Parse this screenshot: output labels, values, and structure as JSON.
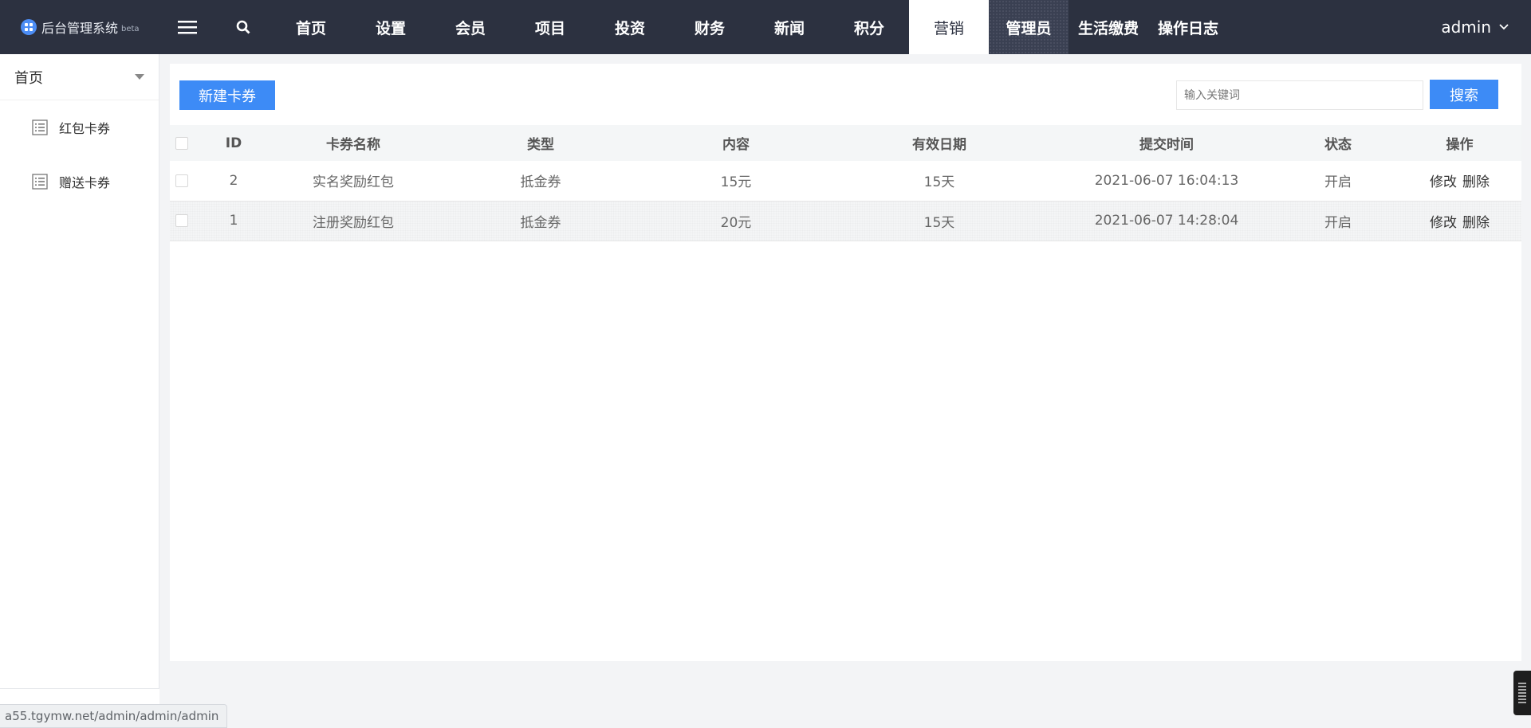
{
  "brand": {
    "title": "后台管理系统",
    "tag": "beta"
  },
  "nav": {
    "items": [
      "首页",
      "设置",
      "会员",
      "项目",
      "投资",
      "财务",
      "新闻",
      "积分",
      "营销",
      "管理员",
      "生活缴费",
      "操作日志"
    ],
    "active": "营销",
    "hover": "管理员"
  },
  "user": {
    "name": "admin"
  },
  "sidebar": {
    "header": "首页",
    "items": [
      {
        "label": "红包卡券",
        "icon": "list-icon"
      },
      {
        "label": "赠送卡券",
        "icon": "list-icon"
      }
    ]
  },
  "toolbar": {
    "new_label": "新建卡券",
    "search_placeholder": "输入关键词",
    "search_label": "搜索"
  },
  "table": {
    "columns": [
      "ID",
      "卡券名称",
      "类型",
      "内容",
      "有效日期",
      "提交时间",
      "状态",
      "操作"
    ],
    "rows": [
      {
        "id": "2",
        "name": "实名奖励红包",
        "type": "抵金券",
        "content": "15元",
        "valid": "15天",
        "time": "2021-06-07 16:04:13",
        "status": "开启"
      },
      {
        "id": "1",
        "name": "注册奖励红包",
        "type": "抵金券",
        "content": "20元",
        "valid": "15天",
        "time": "2021-06-07 14:28:04",
        "status": "开启"
      }
    ],
    "edit_label": "修改",
    "delete_label": "删除"
  },
  "status_bar": {
    "url": "a55.tgymw.net/admin/admin/admin"
  },
  "colors": {
    "topbar": "#2c3140",
    "accent": "#3d8bf6"
  }
}
